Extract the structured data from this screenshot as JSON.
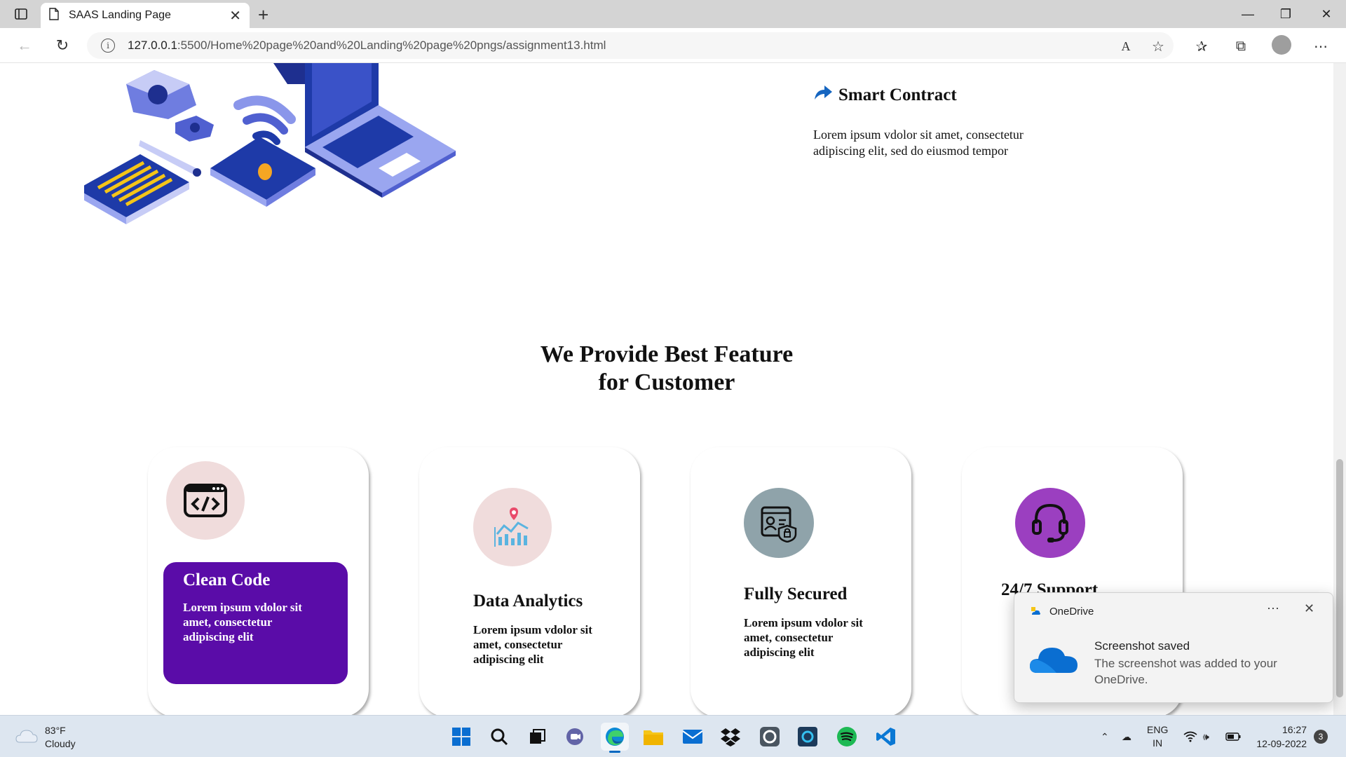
{
  "browser": {
    "tab_title": "SAAS Landing Page",
    "url_host": "127.0.0.1",
    "url_path": ":5500/Home%20page%20and%20Landing%20page%20pngs/assignment13.html"
  },
  "page": {
    "smart_contract": {
      "title": "Smart Contract",
      "text": "Lorem ipsum vdolor sit amet, consectetur adipiscing elit, sed do eiusmod tempor"
    },
    "features": {
      "title_line1": "We Provide Best Feature",
      "title_line2": "for Customer",
      "cards": [
        {
          "title": "Clean Code",
          "text": "Lorem ipsum vdolor sit amet, consectetur adipiscing elit",
          "icon": "code-window-icon",
          "active": true
        },
        {
          "title": "Data Analytics",
          "text": "Lorem ipsum vdolor sit amet, consectetur adipiscing elit",
          "icon": "analytics-chart-icon",
          "active": false
        },
        {
          "title": "Fully Secured",
          "text": "Lorem ipsum vdolor sit amet, consectetur adipiscing elit",
          "icon": "secure-document-icon",
          "active": false
        },
        {
          "title": "24/7 Support",
          "text": "",
          "icon": "headset-icon",
          "active": false
        }
      ]
    }
  },
  "notification": {
    "app": "OneDrive",
    "heading": "Screenshot saved",
    "body": "The screenshot was added to your OneDrive."
  },
  "taskbar": {
    "weather_temp": "83°F",
    "weather_desc": "Cloudy",
    "lang_line1": "ENG",
    "lang_line2": "IN",
    "time": "16:27",
    "date": "12-09-2022",
    "notification_count": "3"
  },
  "colors": {
    "accent_purple": "#5a0ca8",
    "card1_circle": "#f0dcdc",
    "card2_circle": "#f0dcdc",
    "card3_circle": "#8fa3aa",
    "card4_circle": "#9b3fc0"
  }
}
